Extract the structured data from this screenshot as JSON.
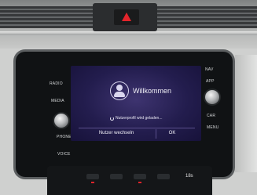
{
  "screen": {
    "title": "Willkommen",
    "status": "Nutzerprofil wird geladen...",
    "buttons": {
      "switch_user": "Nutzer wechseln",
      "ok": "OK"
    },
    "avatar_icon": "user-silhouette-icon",
    "status_icon": "loading-spinner-icon"
  },
  "head_unit": {
    "left_labels": [
      "RADIO",
      "MEDIA",
      "PHONE",
      "VOICE"
    ],
    "right_labels": [
      "NAV",
      "APP",
      "CAR",
      "MENU"
    ]
  },
  "climate": {
    "readout": "18s"
  },
  "colors": {
    "screen_background": "#231d4e",
    "screen_text": "#f1f0f7",
    "hazard": "#e3242b"
  }
}
